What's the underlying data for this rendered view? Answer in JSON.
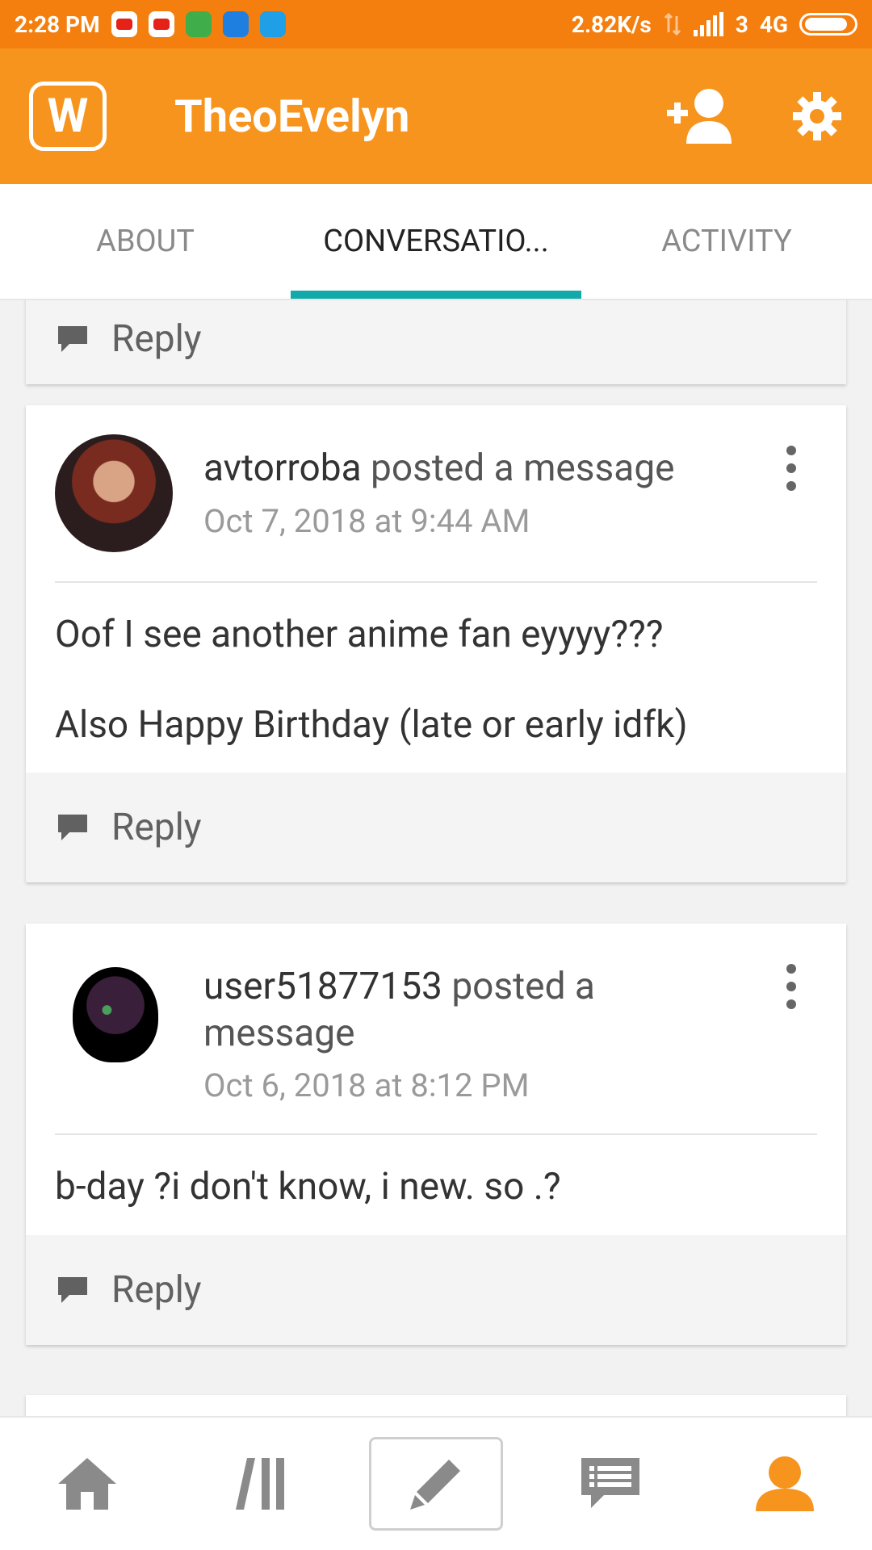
{
  "status_bar": {
    "time": "2:28 PM",
    "network_speed": "2.82K/s",
    "signal_label": "3",
    "network_type": "4G",
    "icons": [
      "youtube-icon",
      "youtube-icon",
      "cat-app-icon",
      "square-app-icon",
      "drop-app-icon"
    ]
  },
  "header": {
    "logo_glyph": "W",
    "title": "TheoEvelyn",
    "actions": [
      "add-person-icon",
      "gear-icon"
    ]
  },
  "tabs": [
    {
      "label": "ABOUT",
      "active": false
    },
    {
      "label": "CONVERSATIO...",
      "active": true
    },
    {
      "label": "ACTIVITY",
      "active": false
    }
  ],
  "feed": {
    "reply_label": "Reply",
    "posts": [
      {
        "username": "avtorroba",
        "action_text": "posted a message",
        "timestamp": "Oct 7, 2018 at 9:44 AM",
        "body": [
          "Oof I see another anime fan eyyyy???",
          "Also Happy Birthday (late or early idfk)"
        ]
      },
      {
        "username": "user51877153",
        "action_text": "posted a message",
        "timestamp": "Oct 6, 2018 at 8:12 PM",
        "body": [
          "b-day ?i don't know, i new. so .?"
        ]
      }
    ]
  },
  "bottom_nav": {
    "items": [
      "home-icon",
      "library-icon",
      "compose-icon",
      "messages-icon",
      "profile-icon"
    ],
    "active_color": "#f7941d",
    "inactive_color": "#8a8a8a"
  },
  "colors": {
    "status_bar": "#f47f0e",
    "app_bar": "#f7941d",
    "tab_indicator": "#12a9aa"
  }
}
